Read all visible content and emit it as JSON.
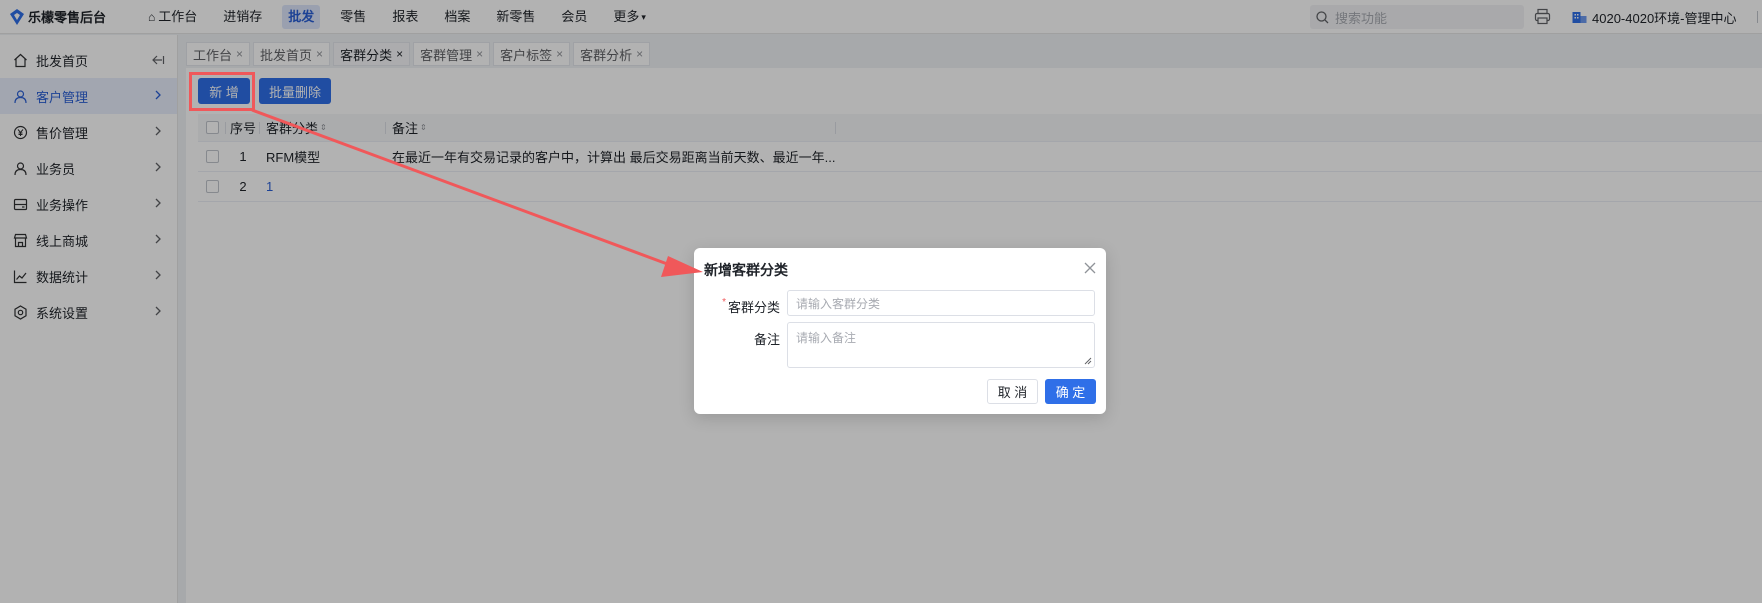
{
  "app": {
    "title": "乐檬零售后台"
  },
  "topnav": {
    "items": [
      {
        "label": "工作台",
        "icon": "home-icon",
        "active": false
      },
      {
        "label": "进销存",
        "active": false
      },
      {
        "label": "批发",
        "active": true
      },
      {
        "label": "零售",
        "active": false
      },
      {
        "label": "报表",
        "active": false
      },
      {
        "label": "档案",
        "active": false
      },
      {
        "label": "新零售",
        "active": false
      },
      {
        "label": "会员",
        "active": false
      },
      {
        "label": "更多",
        "active": false,
        "caret": true
      }
    ],
    "search_placeholder": "搜索功能",
    "org_label": "4020-4020环境-管理中心"
  },
  "sidebar": {
    "items": [
      {
        "label": "批发首页",
        "icon": "home-icon"
      },
      {
        "label": "客户管理",
        "icon": "user-icon",
        "active": true
      },
      {
        "label": "售价管理",
        "icon": "yen-icon"
      },
      {
        "label": "业务员",
        "icon": "user-icon"
      },
      {
        "label": "业务操作",
        "icon": "card-icon"
      },
      {
        "label": "线上商城",
        "icon": "store-icon"
      },
      {
        "label": "数据统计",
        "icon": "chart-icon"
      },
      {
        "label": "系统设置",
        "icon": "settings-icon"
      }
    ]
  },
  "tabs": [
    {
      "label": "工作台",
      "active": false
    },
    {
      "label": "批发首页",
      "active": false
    },
    {
      "label": "客群分类",
      "active": true
    },
    {
      "label": "客群管理",
      "active": false
    },
    {
      "label": "客户标签",
      "active": false
    },
    {
      "label": "客群分析",
      "active": false
    }
  ],
  "toolbar": {
    "add_label": "新 增",
    "batch_delete_label": "批量删除"
  },
  "table": {
    "headers": {
      "seq": "序号",
      "type": "客群分类",
      "note": "备注"
    },
    "rows": [
      {
        "seq": "1",
        "type": "RFM模型",
        "note": "在最近一年有交易记录的客户中，计算出 最后交易距离当前天数、最近一年..."
      },
      {
        "seq": "2",
        "type": "1",
        "note": ""
      }
    ]
  },
  "dialog": {
    "title": "新增客群分类",
    "type_label": "客群分类",
    "type_placeholder": "请输入客群分类",
    "note_label": "备注",
    "note_placeholder": "请输入备注",
    "cancel_label": "取 消",
    "ok_label": "确 定"
  },
  "colors": {
    "primary": "#2f6fe8",
    "annotation": "#f0585a"
  }
}
